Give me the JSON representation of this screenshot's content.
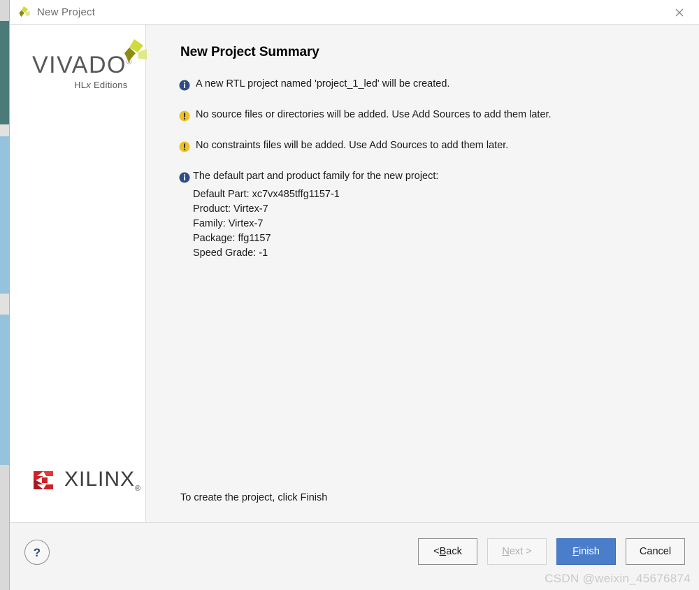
{
  "window": {
    "title": "New Project",
    "app_icon": "vivado-pinwheel-icon",
    "close_icon": "close-icon"
  },
  "sidebar": {
    "vivado_logo": {
      "wordmark": "VIVADO",
      "registered": "®",
      "subtitle_pre": "HL",
      "subtitle_x": "x",
      "subtitle_post": " Editions"
    },
    "xilinx_logo": {
      "wordmark": "XILINX",
      "registered": "®"
    }
  },
  "content": {
    "page_title": "New Project Summary",
    "summary_items": [
      {
        "icon": "info-icon",
        "severity": "info",
        "text": "A new RTL project named 'project_1_led' will be created."
      },
      {
        "icon": "warning-icon",
        "severity": "warning",
        "text": "No source files or directories will be added. Use Add Sources to add them later."
      },
      {
        "icon": "warning-icon",
        "severity": "warning",
        "text": "No constraints files will be added. Use Add Sources to add them later."
      }
    ],
    "part_block": {
      "icon": "info-icon",
      "heading": "The default part and product family for the new project:",
      "details": [
        "Default Part: xc7vx485tffg1157-1",
        "Product: Virtex-7",
        "Family: Virtex-7",
        "Package: ffg1157",
        "Speed Grade: -1"
      ]
    },
    "finish_hint": "To create the project, click Finish"
  },
  "footer": {
    "help_label": "?",
    "buttons": [
      {
        "id": "back",
        "prefix": "< ",
        "mnemonic": "B",
        "suffix": "ack",
        "state": "enabled"
      },
      {
        "id": "next",
        "prefix": "",
        "mnemonic": "N",
        "suffix": "ext >",
        "state": "disabled"
      },
      {
        "id": "finish",
        "prefix": "",
        "mnemonic": "F",
        "suffix": "inish",
        "state": "primary"
      },
      {
        "id": "cancel",
        "prefix": "",
        "mnemonic": "",
        "suffix": "Cancel",
        "state": "enabled"
      }
    ]
  },
  "watermark": {
    "text": "CSDN @weixin_45676874"
  },
  "colors": {
    "accent_blue": "#4a7ecb",
    "info_icon": "#2e4d86",
    "warning_icon": "#ecc126",
    "xilinx_red": "#cf2027",
    "vivado_gray": "#58585a",
    "desktop_teal": "#4a7b78",
    "desktop_blue": "#95c2dd"
  }
}
